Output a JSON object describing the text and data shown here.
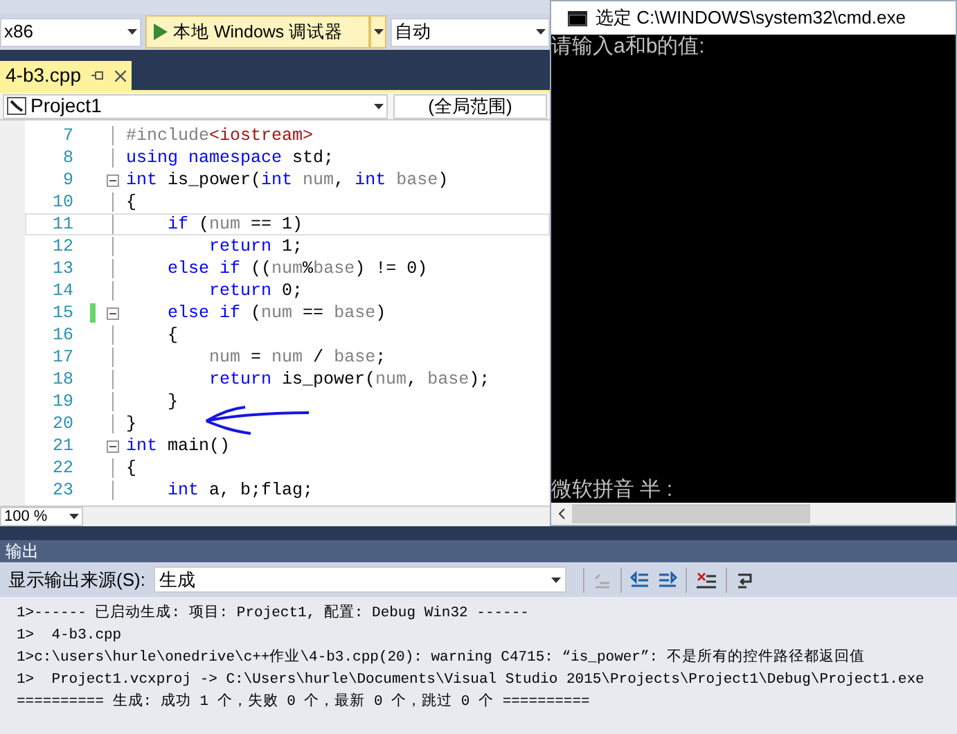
{
  "toolbar": {
    "platform": "x86",
    "debugger": "本地 Windows 调试器",
    "config": "自动"
  },
  "tabs": [
    {
      "label": "4-b3.cpp",
      "selected": true
    }
  ],
  "nav": {
    "project": "Project1",
    "scope": "(全局范围)"
  },
  "code": [
    {
      "n": "7",
      "fold": false,
      "changed": false,
      "current": false,
      "tokens": [
        {
          "text": "#include",
          "kind": "pre"
        },
        {
          "text": "<iostream>",
          "kind": "str"
        }
      ]
    },
    {
      "n": "8",
      "fold": false,
      "changed": false,
      "current": false,
      "tokens": [
        {
          "text": "using namespace",
          "kind": "kw"
        },
        {
          "text": " std;",
          "kind": "plain"
        }
      ]
    },
    {
      "n": "9",
      "fold": true,
      "changed": false,
      "current": false,
      "tokens": [
        {
          "text": "int",
          "kind": "kw"
        },
        {
          "text": " is_power(",
          "kind": "plain"
        },
        {
          "text": "int",
          "kind": "kw"
        },
        {
          "text": " num",
          "kind": "id"
        },
        {
          "text": ", ",
          "kind": "plain"
        },
        {
          "text": "int",
          "kind": "kw"
        },
        {
          "text": " base",
          "kind": "id"
        },
        {
          "text": ")",
          "kind": "plain"
        }
      ]
    },
    {
      "n": "10",
      "fold": false,
      "changed": false,
      "current": false,
      "tokens": [
        {
          "text": "{",
          "kind": "plain"
        }
      ]
    },
    {
      "n": "11",
      "fold": false,
      "changed": false,
      "current": true,
      "tokens": [
        {
          "text": "    if",
          "kind": "kw"
        },
        {
          "text": " (",
          "kind": "plain"
        },
        {
          "text": "num",
          "kind": "id"
        },
        {
          "text": " == 1)",
          "kind": "plain"
        }
      ]
    },
    {
      "n": "12",
      "fold": false,
      "changed": false,
      "current": false,
      "tokens": [
        {
          "text": "        return",
          "kind": "kw"
        },
        {
          "text": " 1;",
          "kind": "plain"
        }
      ]
    },
    {
      "n": "13",
      "fold": false,
      "changed": false,
      "current": false,
      "tokens": [
        {
          "text": "    else if",
          "kind": "kw"
        },
        {
          "text": " ((",
          "kind": "plain"
        },
        {
          "text": "num",
          "kind": "id"
        },
        {
          "text": "%",
          "kind": "plain"
        },
        {
          "text": "base",
          "kind": "id"
        },
        {
          "text": ") != 0)",
          "kind": "plain"
        }
      ]
    },
    {
      "n": "14",
      "fold": false,
      "changed": false,
      "current": false,
      "tokens": [
        {
          "text": "        return",
          "kind": "kw"
        },
        {
          "text": " 0;",
          "kind": "plain"
        }
      ]
    },
    {
      "n": "15",
      "fold": true,
      "changed": true,
      "current": false,
      "tokens": [
        {
          "text": "    else if",
          "kind": "kw"
        },
        {
          "text": " (",
          "kind": "plain"
        },
        {
          "text": "num",
          "kind": "id"
        },
        {
          "text": " == ",
          "kind": "plain"
        },
        {
          "text": "base",
          "kind": "id"
        },
        {
          "text": ")",
          "kind": "plain"
        }
      ]
    },
    {
      "n": "16",
      "fold": false,
      "changed": false,
      "current": false,
      "tokens": [
        {
          "text": "    {",
          "kind": "plain"
        }
      ]
    },
    {
      "n": "17",
      "fold": false,
      "changed": false,
      "current": false,
      "tokens": [
        {
          "text": "        num",
          "kind": "id"
        },
        {
          "text": " = ",
          "kind": "plain"
        },
        {
          "text": "num",
          "kind": "id"
        },
        {
          "text": " / ",
          "kind": "plain"
        },
        {
          "text": "base",
          "kind": "id"
        },
        {
          "text": ";",
          "kind": "plain"
        }
      ]
    },
    {
      "n": "18",
      "fold": false,
      "changed": false,
      "current": false,
      "tokens": [
        {
          "text": "        return",
          "kind": "kw"
        },
        {
          "text": " is_power(",
          "kind": "plain"
        },
        {
          "text": "num",
          "kind": "id"
        },
        {
          "text": ", ",
          "kind": "plain"
        },
        {
          "text": "base",
          "kind": "id"
        },
        {
          "text": ");",
          "kind": "plain"
        }
      ]
    },
    {
      "n": "19",
      "fold": false,
      "changed": false,
      "current": false,
      "tokens": [
        {
          "text": "    }",
          "kind": "plain"
        }
      ]
    },
    {
      "n": "20",
      "fold": false,
      "changed": false,
      "current": false,
      "tokens": [
        {
          "text": "}",
          "kind": "plain"
        }
      ]
    },
    {
      "n": "21",
      "fold": true,
      "changed": false,
      "current": false,
      "tokens": [
        {
          "text": "int",
          "kind": "kw"
        },
        {
          "text": " main()",
          "kind": "plain"
        }
      ]
    },
    {
      "n": "22",
      "fold": false,
      "changed": false,
      "current": false,
      "tokens": [
        {
          "text": "{",
          "kind": "plain"
        }
      ]
    },
    {
      "n": "23",
      "fold": false,
      "changed": false,
      "current": false,
      "tokens": [
        {
          "text": "    int",
          "kind": "kw"
        },
        {
          "text": " a, b;flag;",
          "kind": "plain"
        }
      ]
    }
  ],
  "zoom": "100 %",
  "console": {
    "title": "选定 C:\\WINDOWS\\system32\\cmd.exe",
    "lines": [
      "请输入a和b的值:"
    ],
    "ime": "微软拼音 半 :"
  },
  "output": {
    "title": "输出",
    "source_label": "显示输出来源(S):",
    "source": "生成",
    "lines": [
      "1>------ 已启动生成: 项目: Project1, 配置: Debug Win32 ------",
      "1>  4-b3.cpp",
      "1>c:\\users\\hurle\\onedrive\\c++作业\\4-b3.cpp(20): warning C4715: “is_power”: 不是所有的控件路径都返回值",
      "1>  Project1.vcxproj -> C:\\Users\\hurle\\Documents\\Visual Studio 2015\\Projects\\Project1\\Debug\\Project1.exe",
      "========== 生成: 成功 1 个，失败 0 个，最新 0 个，跳过 0 个 =========="
    ]
  }
}
